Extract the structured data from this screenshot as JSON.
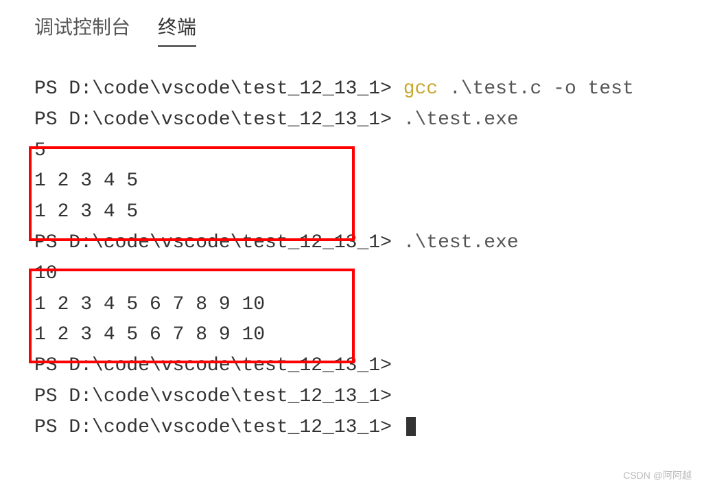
{
  "tabs": {
    "debug_console": "调试控制台",
    "terminal": "终端"
  },
  "lines": {
    "l1_prompt": "PS D:\\code\\vscode\\test_12_13_1> ",
    "l1_cmd_hl": "gcc",
    "l1_cmd_rest": " .\\test.c -o test",
    "l2_prompt": "PS D:\\code\\vscode\\test_12_13_1> ",
    "l2_cmd": ".\\test.exe",
    "l3": "5",
    "l4": "1 2 3 4 5",
    "l5": "1 2 3 4 5",
    "l6_prompt": "PS D:\\code\\vscode\\test_12_13_1> ",
    "l6_cmd": ".\\test.exe",
    "l7": "10",
    "l8": "1 2 3 4 5 6 7 8 9 10",
    "l9": "1 2 3 4 5 6 7 8 9 10",
    "l10_prompt": "PS D:\\code\\vscode\\test_12_13_1> ",
    "l11_prompt": "PS D:\\code\\vscode\\test_12_13_1> ",
    "l12_prompt": "PS D:\\code\\vscode\\test_12_13_1> "
  },
  "watermark": "CSDN @阿阿越"
}
